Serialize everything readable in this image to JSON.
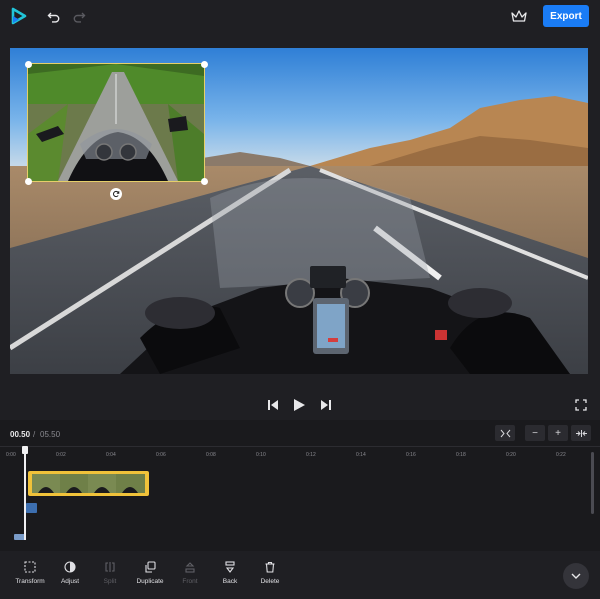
{
  "header": {
    "export_label": "Export",
    "icons": [
      "logo-play-icon",
      "undo-icon",
      "redo-icon",
      "crown-icon"
    ]
  },
  "player": {
    "current_time": "00.50",
    "separator": "/",
    "total_time": "05.50"
  },
  "timeline": {
    "ticks": [
      "0:00",
      "0:02",
      "0:04",
      "0:06",
      "0:08",
      "0:10",
      "0:12",
      "0:14",
      "0:16",
      "0:18",
      "0:20",
      "0:22"
    ],
    "zoom_in_label": "+",
    "zoom_out_label": "−"
  },
  "toolbar": {
    "items": [
      {
        "label": "Transform",
        "enabled": true
      },
      {
        "label": "Adjust",
        "enabled": true
      },
      {
        "label": "Split",
        "enabled": false
      },
      {
        "label": "Duplicate",
        "enabled": true
      },
      {
        "label": "Front",
        "enabled": false
      },
      {
        "label": "Back",
        "enabled": true
      },
      {
        "label": "Delete",
        "enabled": true
      }
    ]
  },
  "colors": {
    "accent": "#1a7cf5",
    "clip": "#f0c23a",
    "logo": "#21c4d8"
  }
}
